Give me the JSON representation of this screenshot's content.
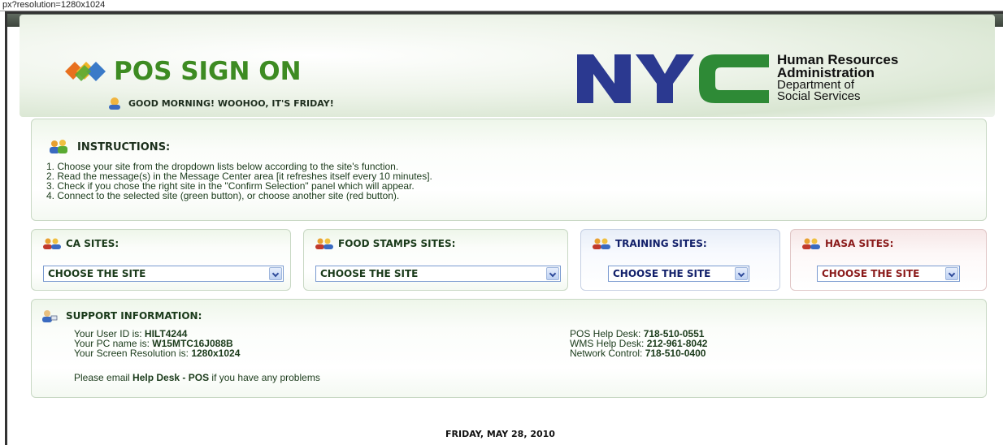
{
  "url_fragment": "px?resolution=1280x1024",
  "header": {
    "title": "POS SIGN ON",
    "greeting": "GOOD MORNING! WOOHOO, IT'S FRIDAY!",
    "org_line1": "Human Resources",
    "org_line2": "Administration",
    "org_line3": "Department of",
    "org_line4": "Social Services",
    "nyc_text": "NYC"
  },
  "instructions": {
    "title": "INSTRUCTIONS:",
    "items": [
      "1. Choose your site from the dropdown lists below according to the site's function.",
      "2. Read the message(s) in the Message Center area [it refreshes itself every 10 minutes].",
      "3. Check if you chose the right site in the \"Confirm Selection\" panel which will appear.",
      "4. Connect to the selected site (green button), or choose another site (red button)."
    ]
  },
  "sites": {
    "ca": {
      "title": "CA SITES:",
      "selected": "CHOOSE THE SITE",
      "color": "#1a3a1a"
    },
    "food": {
      "title": "FOOD STAMPS SITES:",
      "selected": "CHOOSE THE SITE",
      "color": "#1a3a1a"
    },
    "training": {
      "title": "TRAINING SITES:",
      "selected": "CHOOSE THE SITE",
      "color": "#12206a"
    },
    "hasa": {
      "title": "HASA SITES:",
      "selected": "CHOOSE THE SITE",
      "color": "#8a1a1a"
    }
  },
  "support": {
    "title": "SUPPORT INFORMATION:",
    "user_id_label": "Your User ID is: ",
    "user_id": "HILT4244",
    "pc_name_label": "Your PC name is: ",
    "pc_name": "W15MTC16J088B",
    "resolution_label": "Your Screen Resolution is: ",
    "resolution": "1280x1024",
    "pos_help_label": "POS Help Desk: ",
    "pos_help": "718-510-0551",
    "wms_help_label": "WMS Help Desk: ",
    "wms_help": "212-961-8042",
    "network_label": "Network Control: ",
    "network": "718-510-0400",
    "email_prefix": "Please email ",
    "email_link": "Help Desk - POS",
    "email_suffix": " if you have any problems"
  },
  "footer": {
    "date": "FRIDAY, MAY 28, 2010"
  },
  "colors": {
    "accent_green": "#3d8b22",
    "nyc_blue": "#2b3990",
    "nyc_green": "#2e8a36"
  }
}
